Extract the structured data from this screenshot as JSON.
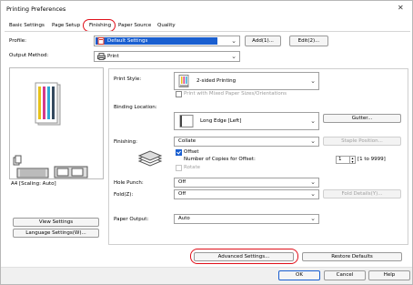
{
  "window": {
    "title": "Printing Preferences",
    "close_glyph": "✕"
  },
  "tabs": [
    {
      "label": "Basic Settings"
    },
    {
      "label": "Page Setup"
    },
    {
      "label": "Finishing"
    },
    {
      "label": "Paper Source"
    },
    {
      "label": "Quality"
    }
  ],
  "profile": {
    "label": "Profile:",
    "value": "Default Settings",
    "add_label": "Add(1)...",
    "edit_label": "Edit(2)..."
  },
  "output_method": {
    "label": "Output Method:",
    "value": "Print"
  },
  "preview": {
    "scaling_text": "A4 [Scaling: Auto]"
  },
  "left_buttons": {
    "view_settings": "View Settings",
    "language_settings": "Language Settings(W)..."
  },
  "print_style": {
    "label": "Print Style:",
    "value": "2-sided Printing",
    "mixed_label": "Print with Mixed Paper Sizes/Orientations",
    "mixed_checked": false
  },
  "binding": {
    "label": "Binding Location:",
    "value": "Long Edge [Left]",
    "gutter_label": "Gutter..."
  },
  "finishing": {
    "label": "Finishing:",
    "value": "Collate",
    "staple_label": "Staple Position...",
    "offset_label": "Offset",
    "offset_checked": true,
    "copies_label": "Number of Copies for Offset:",
    "copies_value": "1",
    "copies_range": "[1 to 9999]",
    "rotate_label": "Rotate",
    "rotate_checked": false
  },
  "hole_punch": {
    "label": "Hole Punch:",
    "value": "Off"
  },
  "fold": {
    "label": "Fold(Z):",
    "value": "Off",
    "details_label": "Fold Details(Y)..."
  },
  "paper_output": {
    "label": "Paper Output:",
    "value": "Auto"
  },
  "bottom": {
    "advanced": "Advanced Settings...",
    "restore": "Restore Defaults",
    "ok": "OK",
    "cancel": "Cancel",
    "help": "Help"
  },
  "colors": {
    "highlight_ring": "#e0101a",
    "selection": "#1a5fd0",
    "check": "#1a5fd0"
  },
  "icons": {
    "profile": "printer-profile-icon",
    "output": "printer-icon",
    "print_style": "duplex-page-icon",
    "binding": "binding-page-icon",
    "finishing": "stacked-paper-icon"
  }
}
